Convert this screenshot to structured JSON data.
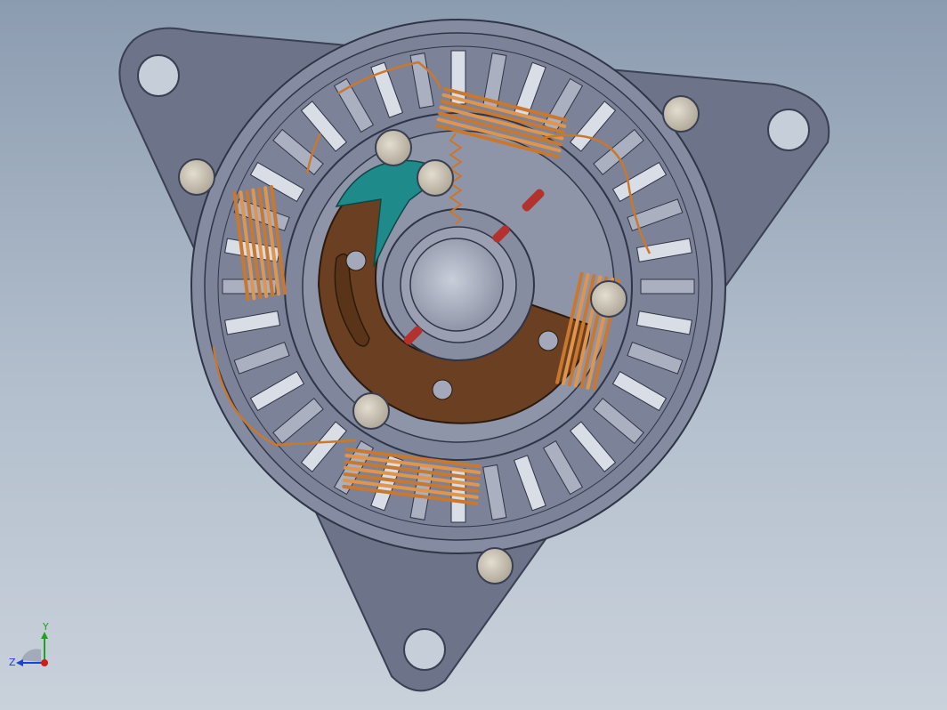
{
  "triad": {
    "y_label": "Y",
    "z_label": "Z",
    "y_color": "#1ba51b",
    "z_color": "#1f3fd6",
    "origin_color": "#d11b1b"
  },
  "colors": {
    "background_top": "#8c9cb0",
    "background_bottom": "#c9d1db",
    "housing": "#6d7388",
    "housing_edge": "#3a3f52",
    "stator": "#8a90a3",
    "slot_light": "#d9dde6",
    "copper_winding": "#c9782e",
    "brush_plate": "#6b3f22",
    "teal_part": "#1e8a8a",
    "bolt": "#c8c0ad",
    "resistor": "#b3322e",
    "bearing": "#a8aebe"
  },
  "icons": {
    "bolt": "bolt-head-icon",
    "mount_hole": "mount-hole-icon",
    "coil": "copper-coil-icon",
    "spring": "spring-icon",
    "resistor": "resistor-icon"
  }
}
